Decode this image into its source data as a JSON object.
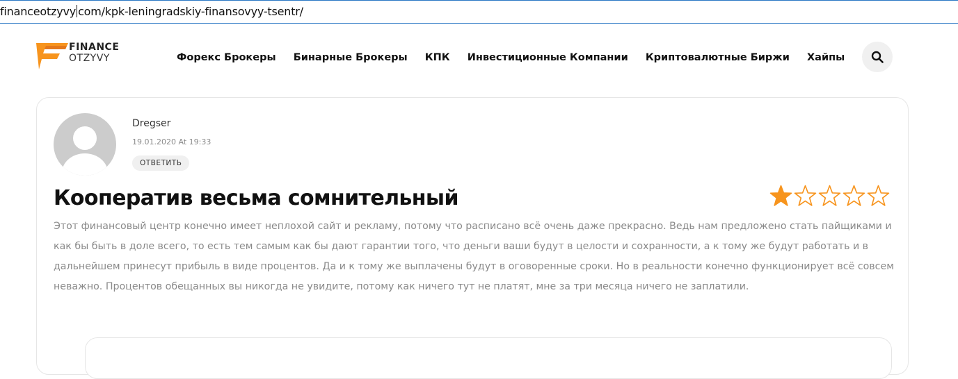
{
  "browser": {
    "url_domain": "financeotzyvy",
    "url_path": "com/kpk-leningradskiy-finansovyy-tsentr/"
  },
  "header": {
    "logo": {
      "word1": "FINANCE",
      "word2": "OTZYVY",
      "accent": "#f7941d"
    },
    "nav": [
      {
        "label": "Форекс Брокеры"
      },
      {
        "label": "Бинарные Брокеры"
      },
      {
        "label": "КПК"
      },
      {
        "label": "Инвестиционные Компании"
      },
      {
        "label": "Криптовалютные Биржи"
      },
      {
        "label": "Хайпы"
      }
    ],
    "search_icon": "search-icon"
  },
  "review": {
    "author": "Dregser",
    "date": "19.01.2020 At 19:33",
    "reply_label": "ОТВЕТИТЬ",
    "title": "Кооператив весьма сомнительный",
    "rating": 1,
    "rating_max": 5,
    "star_color": "#f7941d",
    "text": "Этот финансовый центр конечно имеет неплохой сайт и рекламу, потому что расписано всё очень даже прекрасно. Ведь нам предложено стать пайщиками и как бы быть в доле всего, то есть тем самым как бы дают гарантии того, что деньги ваши будут в целости и сохранности, а к тому же будут работать и в дальнейшем принесут прибыль в виде процентов. Да и к тому же выплачены будут в оговоренные сроки. Но в реальности конечно функционирует всё совсем неважно. Процентов обещанных вы никогда не увидите, потому как ничего тут не платят, мне за три месяца ничего не заплатили."
  }
}
